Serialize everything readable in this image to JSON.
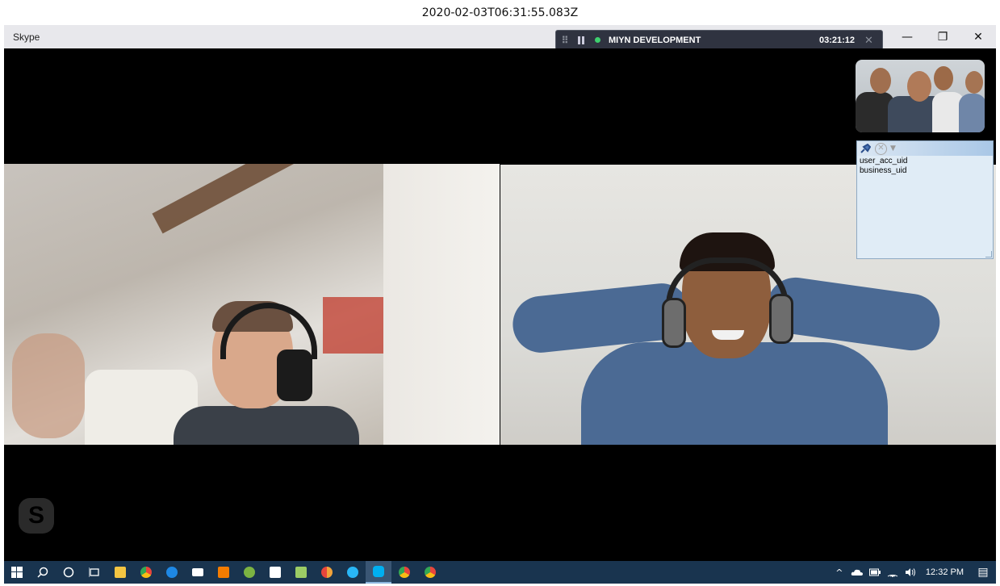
{
  "timestamp": "2020-02-03T06:31:55.083Z",
  "window": {
    "app_title": "Skype",
    "controls": {
      "minimize": "—",
      "restore": "❐",
      "close": "✕"
    }
  },
  "call_bar": {
    "grip": "⠿",
    "status_color": "#3ecf6e",
    "call_name": "MIYN DEVELOPMENT",
    "duration": "03:21:12",
    "close": "✕"
  },
  "note_panel": {
    "close": "✕",
    "dropdown": "▼",
    "lines": [
      "user_acc_uid",
      "business_uid"
    ]
  },
  "skype_logo": "S",
  "taskbar": {
    "apps": [
      {
        "name": "start-button",
        "color": "#ffffff"
      },
      {
        "name": "search-button",
        "color": "#ffffff"
      },
      {
        "name": "cortana-button",
        "color": "#ffffff"
      },
      {
        "name": "task-view-button",
        "color": "#ffffff"
      },
      {
        "name": "file-explorer-app",
        "color": "#f4c542"
      },
      {
        "name": "chrome-app",
        "color": "#e8453c"
      },
      {
        "name": "edge-app",
        "color": "#1e88e5"
      },
      {
        "name": "mail-app",
        "color": "#ffffff"
      },
      {
        "name": "xampp-app",
        "color": "#f57c00"
      },
      {
        "name": "utility-app",
        "color": "#7cb342"
      },
      {
        "name": "store-app",
        "color": "#ffffff"
      },
      {
        "name": "notepad-app",
        "color": "#9ccc65"
      },
      {
        "name": "chrome-alt-app",
        "color": "#f2a33a"
      },
      {
        "name": "browser-app",
        "color": "#29b6f6"
      },
      {
        "name": "skype-app",
        "color": "#00aff0"
      },
      {
        "name": "chrome-profile-app",
        "color": "#e8453c"
      },
      {
        "name": "chrome-profile2-app",
        "color": "#e8453c"
      }
    ],
    "tray": {
      "chevron": "^",
      "clock": "12:32 PM",
      "notifications": "▤"
    }
  }
}
